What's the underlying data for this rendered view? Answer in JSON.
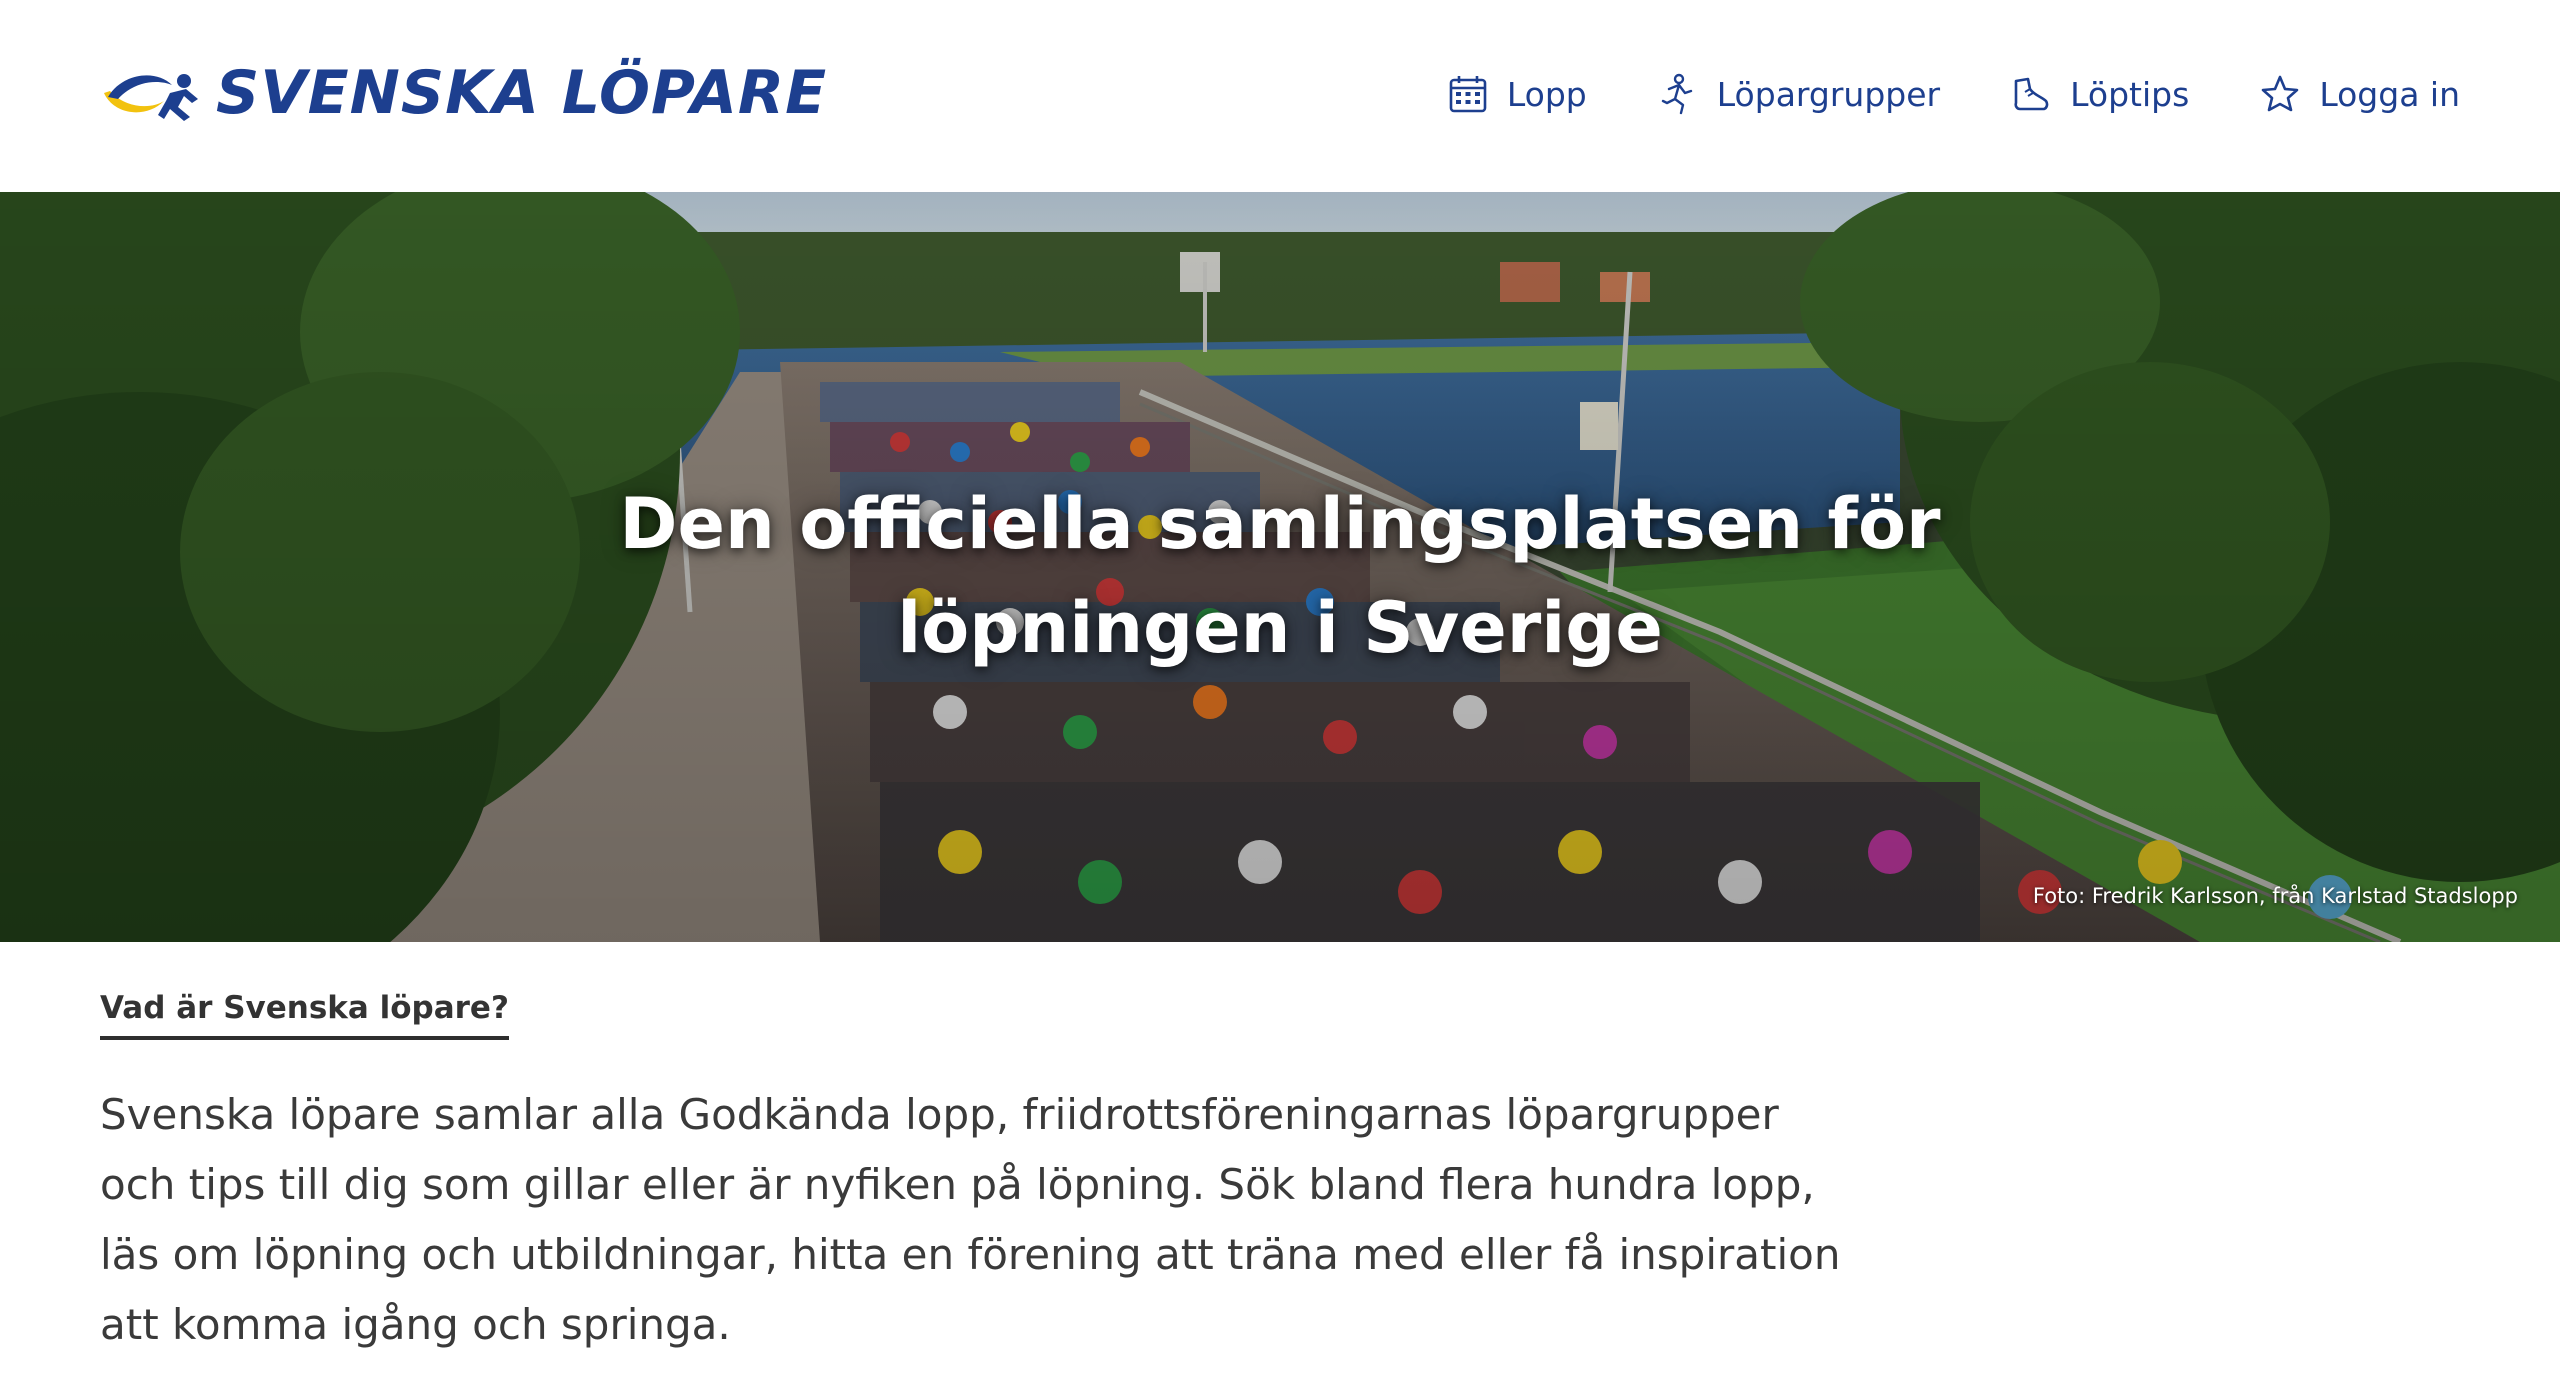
{
  "header": {
    "logo_text": "SVENSKA LÖPARE",
    "logo_icon": "runner-swoosh-logo",
    "nav": [
      {
        "label": "Lopp",
        "icon": "calendar-icon"
      },
      {
        "label": "Löpargrupper",
        "icon": "runners-icon"
      },
      {
        "label": "Löptips",
        "icon": "shoe-icon"
      },
      {
        "label": "Logga in",
        "icon": "star-icon"
      }
    ]
  },
  "hero": {
    "title": "Den officiella samlingsplatsen för löpningen i Sverige",
    "photo_credit": "Foto: Fredrik Karlsson, från Karlstad Stadslopp"
  },
  "intro": {
    "heading": "Vad är Svenska löpare?",
    "text": "Svenska löpare samlar alla Godkända lopp, friidrottsföreningarnas löpargrupper och tips till dig som gillar eller är nyfiken på löpning. Sök bland flera hundra lopp, läs om löpning och utbildningar, hitta en förening att träna med eller få inspiration att komma igång och springa."
  },
  "colors": {
    "brand_blue": "#1d3f8f",
    "brand_yellow": "#f2c20f",
    "text": "#3a3a3a"
  }
}
